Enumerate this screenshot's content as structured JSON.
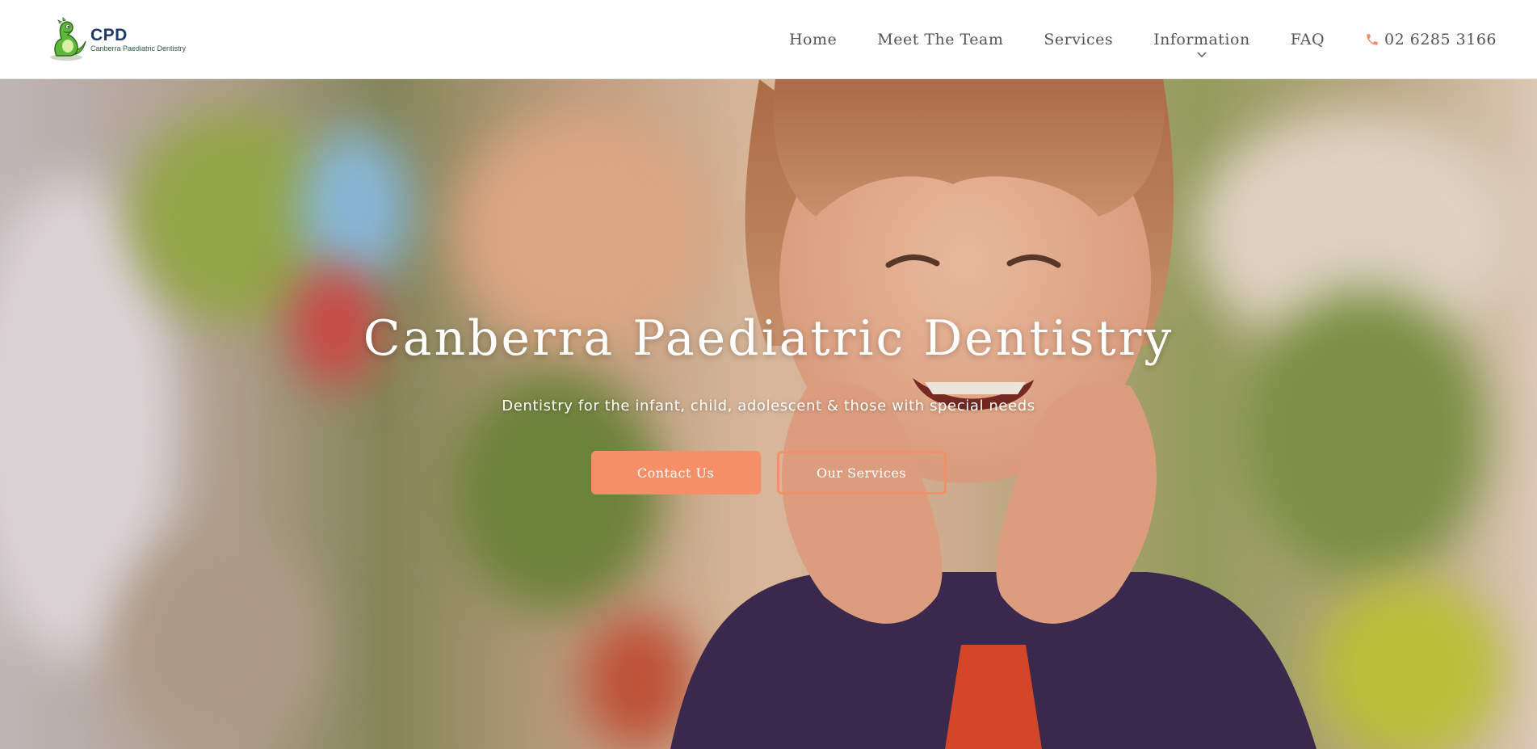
{
  "brand": {
    "logo_abbr": "CPD",
    "logo_full": "Canberra Paediatric Dentistry",
    "accent_color": "#f48f67"
  },
  "nav": {
    "items": [
      {
        "label": "Home"
      },
      {
        "label": "Meet The Team"
      },
      {
        "label": "Services"
      },
      {
        "label": "Information"
      },
      {
        "label": "FAQ"
      }
    ],
    "phone": "02 6285 3166"
  },
  "hero": {
    "title": "Canberra Paediatric Dentistry",
    "subtitle": "Dentistry for the infant, child, adolescent & those with special needs",
    "primary_button": "Contact Us",
    "secondary_button": "Our Services"
  },
  "icons": {
    "logo": "dinosaur-logo-icon",
    "phone": "phone-icon",
    "dropdown": "chevron-down-icon"
  }
}
